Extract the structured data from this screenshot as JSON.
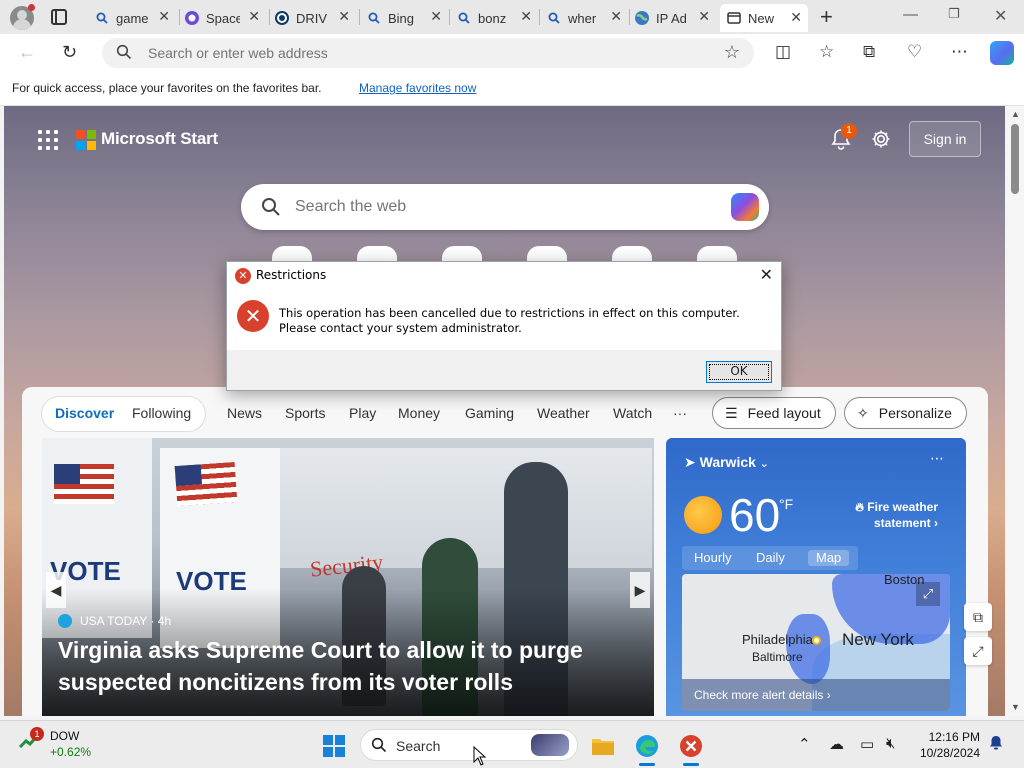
{
  "browser": {
    "tabs": [
      {
        "label": "game",
        "icon": "search-icon"
      },
      {
        "label": "Space",
        "icon": "space-icon"
      },
      {
        "label": "DRIV",
        "icon": "drive-icon"
      },
      {
        "label": "Bing",
        "icon": "search-icon"
      },
      {
        "label": "bonz",
        "icon": "search-icon"
      },
      {
        "label": "wher",
        "icon": "search-icon"
      },
      {
        "label": "IP Ad",
        "icon": "globe-icon"
      },
      {
        "label": "New",
        "icon": "newtab-icon",
        "active": true
      }
    ],
    "address_placeholder": "Search or enter web address",
    "favorites_hint": "For quick access, place your favorites on the favorites bar.",
    "favorites_link": "Manage favorites now"
  },
  "page": {
    "brand": "Microsoft Start",
    "notification_count": "1",
    "sign_in": "Sign in",
    "web_search_placeholder": "Search the web",
    "feed": {
      "primary_tabs": [
        "Discover",
        "Following"
      ],
      "nav": [
        "News",
        "Sports",
        "Play",
        "Money",
        "Gaming",
        "Weather",
        "Watch",
        "···"
      ],
      "feed_layout": "Feed layout",
      "personalize": "Personalize",
      "hero": {
        "source": "USA TODAY · 4h",
        "headline": "Virginia asks Supreme Court to allow it to purge suspected noncitizens from its voter rolls",
        "sign_vote": "VOTE",
        "sign_security": "Security"
      },
      "weather": {
        "location": "Warwick",
        "temperature": "60",
        "unit": "°F",
        "alert": "Fire weather statement",
        "tabs": [
          "Hourly",
          "Daily",
          "Map"
        ],
        "selected_tab": "Map",
        "map_cities": [
          "Boston",
          "New York",
          "Philadelphia",
          "Baltimore"
        ],
        "map_cta": "Check more alert details"
      }
    }
  },
  "dialog": {
    "title": "Restrictions",
    "message": "This operation has been cancelled due to restrictions in effect on this computer. Please contact your system administrator.",
    "ok": "OK"
  },
  "taskbar": {
    "stock_badge": "1",
    "stock_symbol": "DOW",
    "stock_change": "+0.62%",
    "search_label": "Search",
    "time": "12:16 PM",
    "date": "10/28/2024"
  },
  "colors": {
    "accent": "#0078d4",
    "error": "#d9412f",
    "weather_card": "#3f7ed8"
  }
}
